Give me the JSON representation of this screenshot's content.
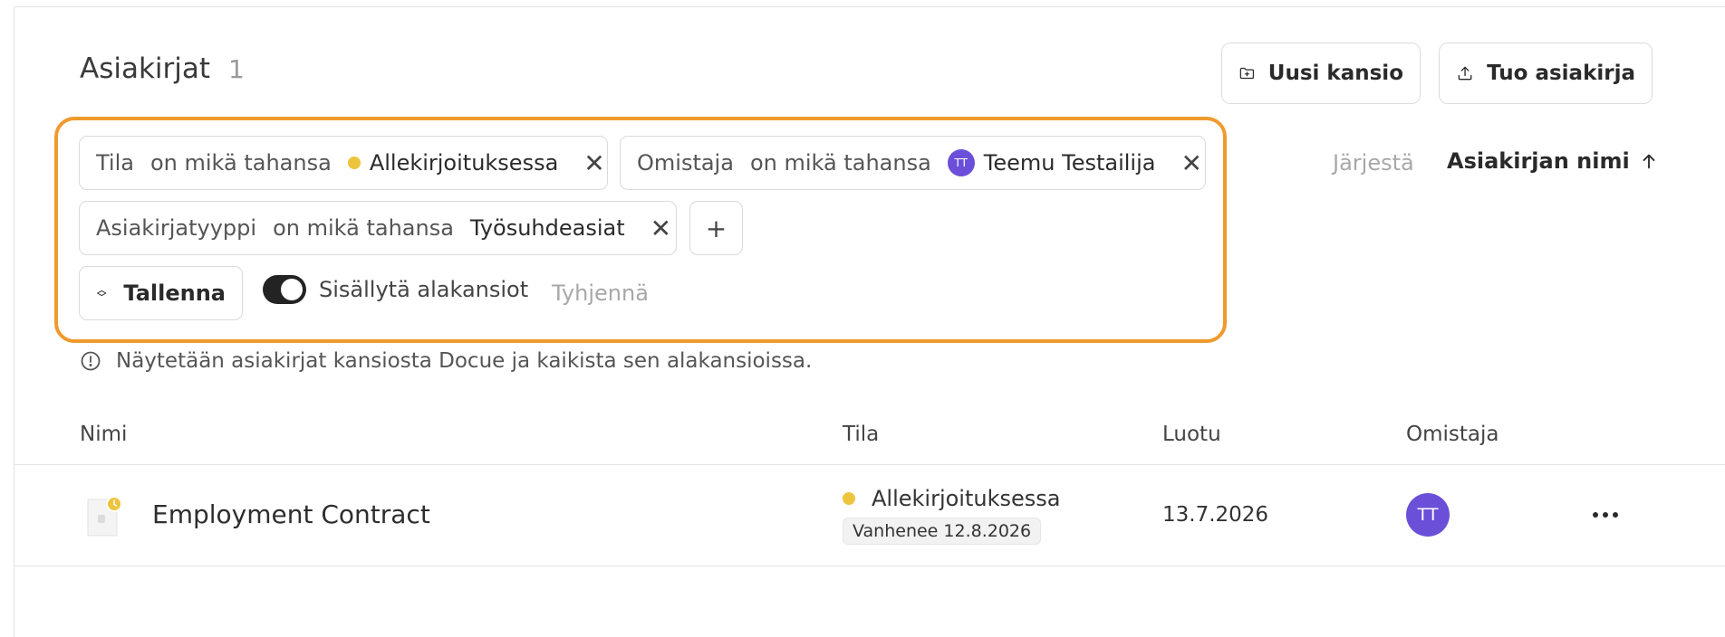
{
  "header": {
    "title": "Asiakirjat",
    "count": "1",
    "new_folder_label": "Uusi kansio",
    "import_label": "Tuo asiakirja"
  },
  "filters": {
    "status": {
      "field": "Tila",
      "operator": "on mikä tahansa",
      "value": "Allekirjoituksessa",
      "dot_color": "#edc43d"
    },
    "owner": {
      "field": "Omistaja",
      "operator": "on mikä tahansa",
      "avatar_initials": "TT",
      "value": "Teemu Testailija"
    },
    "doctype": {
      "field": "Asiakirjatyyppi",
      "operator": "on mikä tahansa",
      "value": "Työsuhdeasiat"
    },
    "add_symbol": "+",
    "remove_symbol": "✕",
    "save_label": "Tallenna",
    "include_subfolders_label": "Sisällytä alakansiot",
    "include_subfolders_on": true,
    "clear_label": "Tyhjennä",
    "highlight_color": "#f09a2e"
  },
  "sort": {
    "label": "Järjestä",
    "value": "Asiakirjan nimi",
    "direction": "ascending"
  },
  "info_text": "Näytetään asiakirjat kansiosta Docue ja kaikista sen alakansioissa.",
  "table": {
    "columns": [
      "Nimi",
      "Tila",
      "Luotu",
      "Omistaja"
    ],
    "rows": [
      {
        "name": "Employment Contract",
        "status": "Allekirjoituksessa",
        "expiry": "Vanhenee 12.8.2026",
        "created": "13.7.2026",
        "owner_initials": "TT"
      }
    ]
  },
  "colors": {
    "status_pending": "#edc43d",
    "avatar": "#6b4fd9"
  }
}
